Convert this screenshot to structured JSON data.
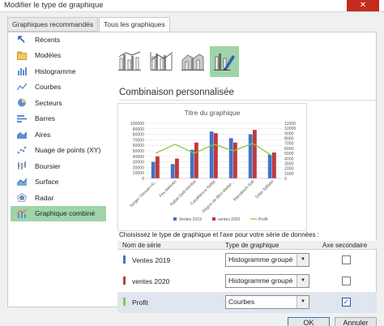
{
  "window": {
    "title": "Modifier le type de graphique",
    "close_icon": "close-icon"
  },
  "tabs": [
    {
      "label": "Graphiques recommandés",
      "active": false
    },
    {
      "label": "Tous les graphiques",
      "active": true
    }
  ],
  "sidebar": {
    "items": [
      {
        "label": "Récents",
        "icon": "recent-icon"
      },
      {
        "label": "Modèles",
        "icon": "folder-icon"
      },
      {
        "label": "Histogramme",
        "icon": "column-chart-icon"
      },
      {
        "label": "Courbes",
        "icon": "line-chart-icon"
      },
      {
        "label": "Secteurs",
        "icon": "pie-chart-icon"
      },
      {
        "label": "Barres",
        "icon": "bar-chart-icon"
      },
      {
        "label": "Aires",
        "icon": "area-chart-icon"
      },
      {
        "label": "Nuage de points (XY)",
        "icon": "scatter-chart-icon"
      },
      {
        "label": "Boursier",
        "icon": "stock-chart-icon"
      },
      {
        "label": "Surface",
        "icon": "surface-chart-icon"
      },
      {
        "label": "Radar",
        "icon": "radar-chart-icon"
      },
      {
        "label": "Graphique combiné",
        "icon": "combo-chart-icon",
        "active": true
      }
    ]
  },
  "chart_types": [
    {
      "icon": "combo-clustered-line-icon"
    },
    {
      "icon": "combo-clustered-line-secondary-icon"
    },
    {
      "icon": "combo-stacked-area-icon"
    },
    {
      "icon": "combo-custom-icon",
      "selected": true
    }
  ],
  "section_title": "Combinaison personnalisée",
  "chart_data": {
    "type": "bar",
    "title": "Titre du graphique",
    "categories": [
      "Tanger-Tétouan-Al...",
      "Fès-Meknès",
      "Rabat-Salé-Kénitra",
      "Casablanca-Settat",
      "Région de Béni Mellal-...",
      "Marrakech-Safi",
      "Drâa-Tafilalet"
    ],
    "series": [
      {
        "name": "Ventes 2019",
        "type": "bar",
        "color": "#4472c4",
        "values": [
          30000,
          26000,
          52000,
          85000,
          73000,
          80000,
          43000
        ]
      },
      {
        "name": "ventes 2020",
        "type": "bar",
        "color": "#c0393b",
        "values": [
          40000,
          36000,
          65000,
          82000,
          65000,
          88000,
          47000
        ]
      },
      {
        "name": "Profit",
        "type": "line",
        "axis": "secondary",
        "color": "#8cc63f",
        "values": [
          5000,
          6800,
          5000,
          6800,
          5500,
          7000,
          4500
        ]
      }
    ],
    "y_primary": {
      "ticks": [
        "0",
        "10000",
        "20000",
        "30000",
        "40000",
        "50000",
        "60000",
        "70000",
        "80000",
        "90000",
        "100000"
      ],
      "range": [
        0,
        100000
      ]
    },
    "y_secondary": {
      "ticks": [
        "0",
        "1000",
        "2000",
        "3000",
        "4000",
        "5000",
        "6000",
        "7000",
        "8000",
        "9000",
        "10000",
        "11000"
      ],
      "range": [
        0,
        11000
      ]
    },
    "legend": "bottom"
  },
  "instruction": "Choisissez le type de graphique et l'axe pour votre série de données :",
  "table": {
    "headers": {
      "name": "Nom de série",
      "type": "Type de graphique",
      "secondary": "Axe secondaire"
    },
    "rows": [
      {
        "name": "Ventes 2019",
        "color": "#4472c4",
        "chart_type": "Histogramme groupé",
        "secondary": false
      },
      {
        "name": "ventes 2020",
        "color": "#c0393b",
        "chart_type": "Histogramme groupé",
        "secondary": false
      },
      {
        "name": "Profit",
        "color": "#8cc63f",
        "chart_type": "Courbes",
        "secondary": true
      }
    ]
  },
  "buttons": {
    "ok": "OK",
    "cancel": "Annuler"
  }
}
